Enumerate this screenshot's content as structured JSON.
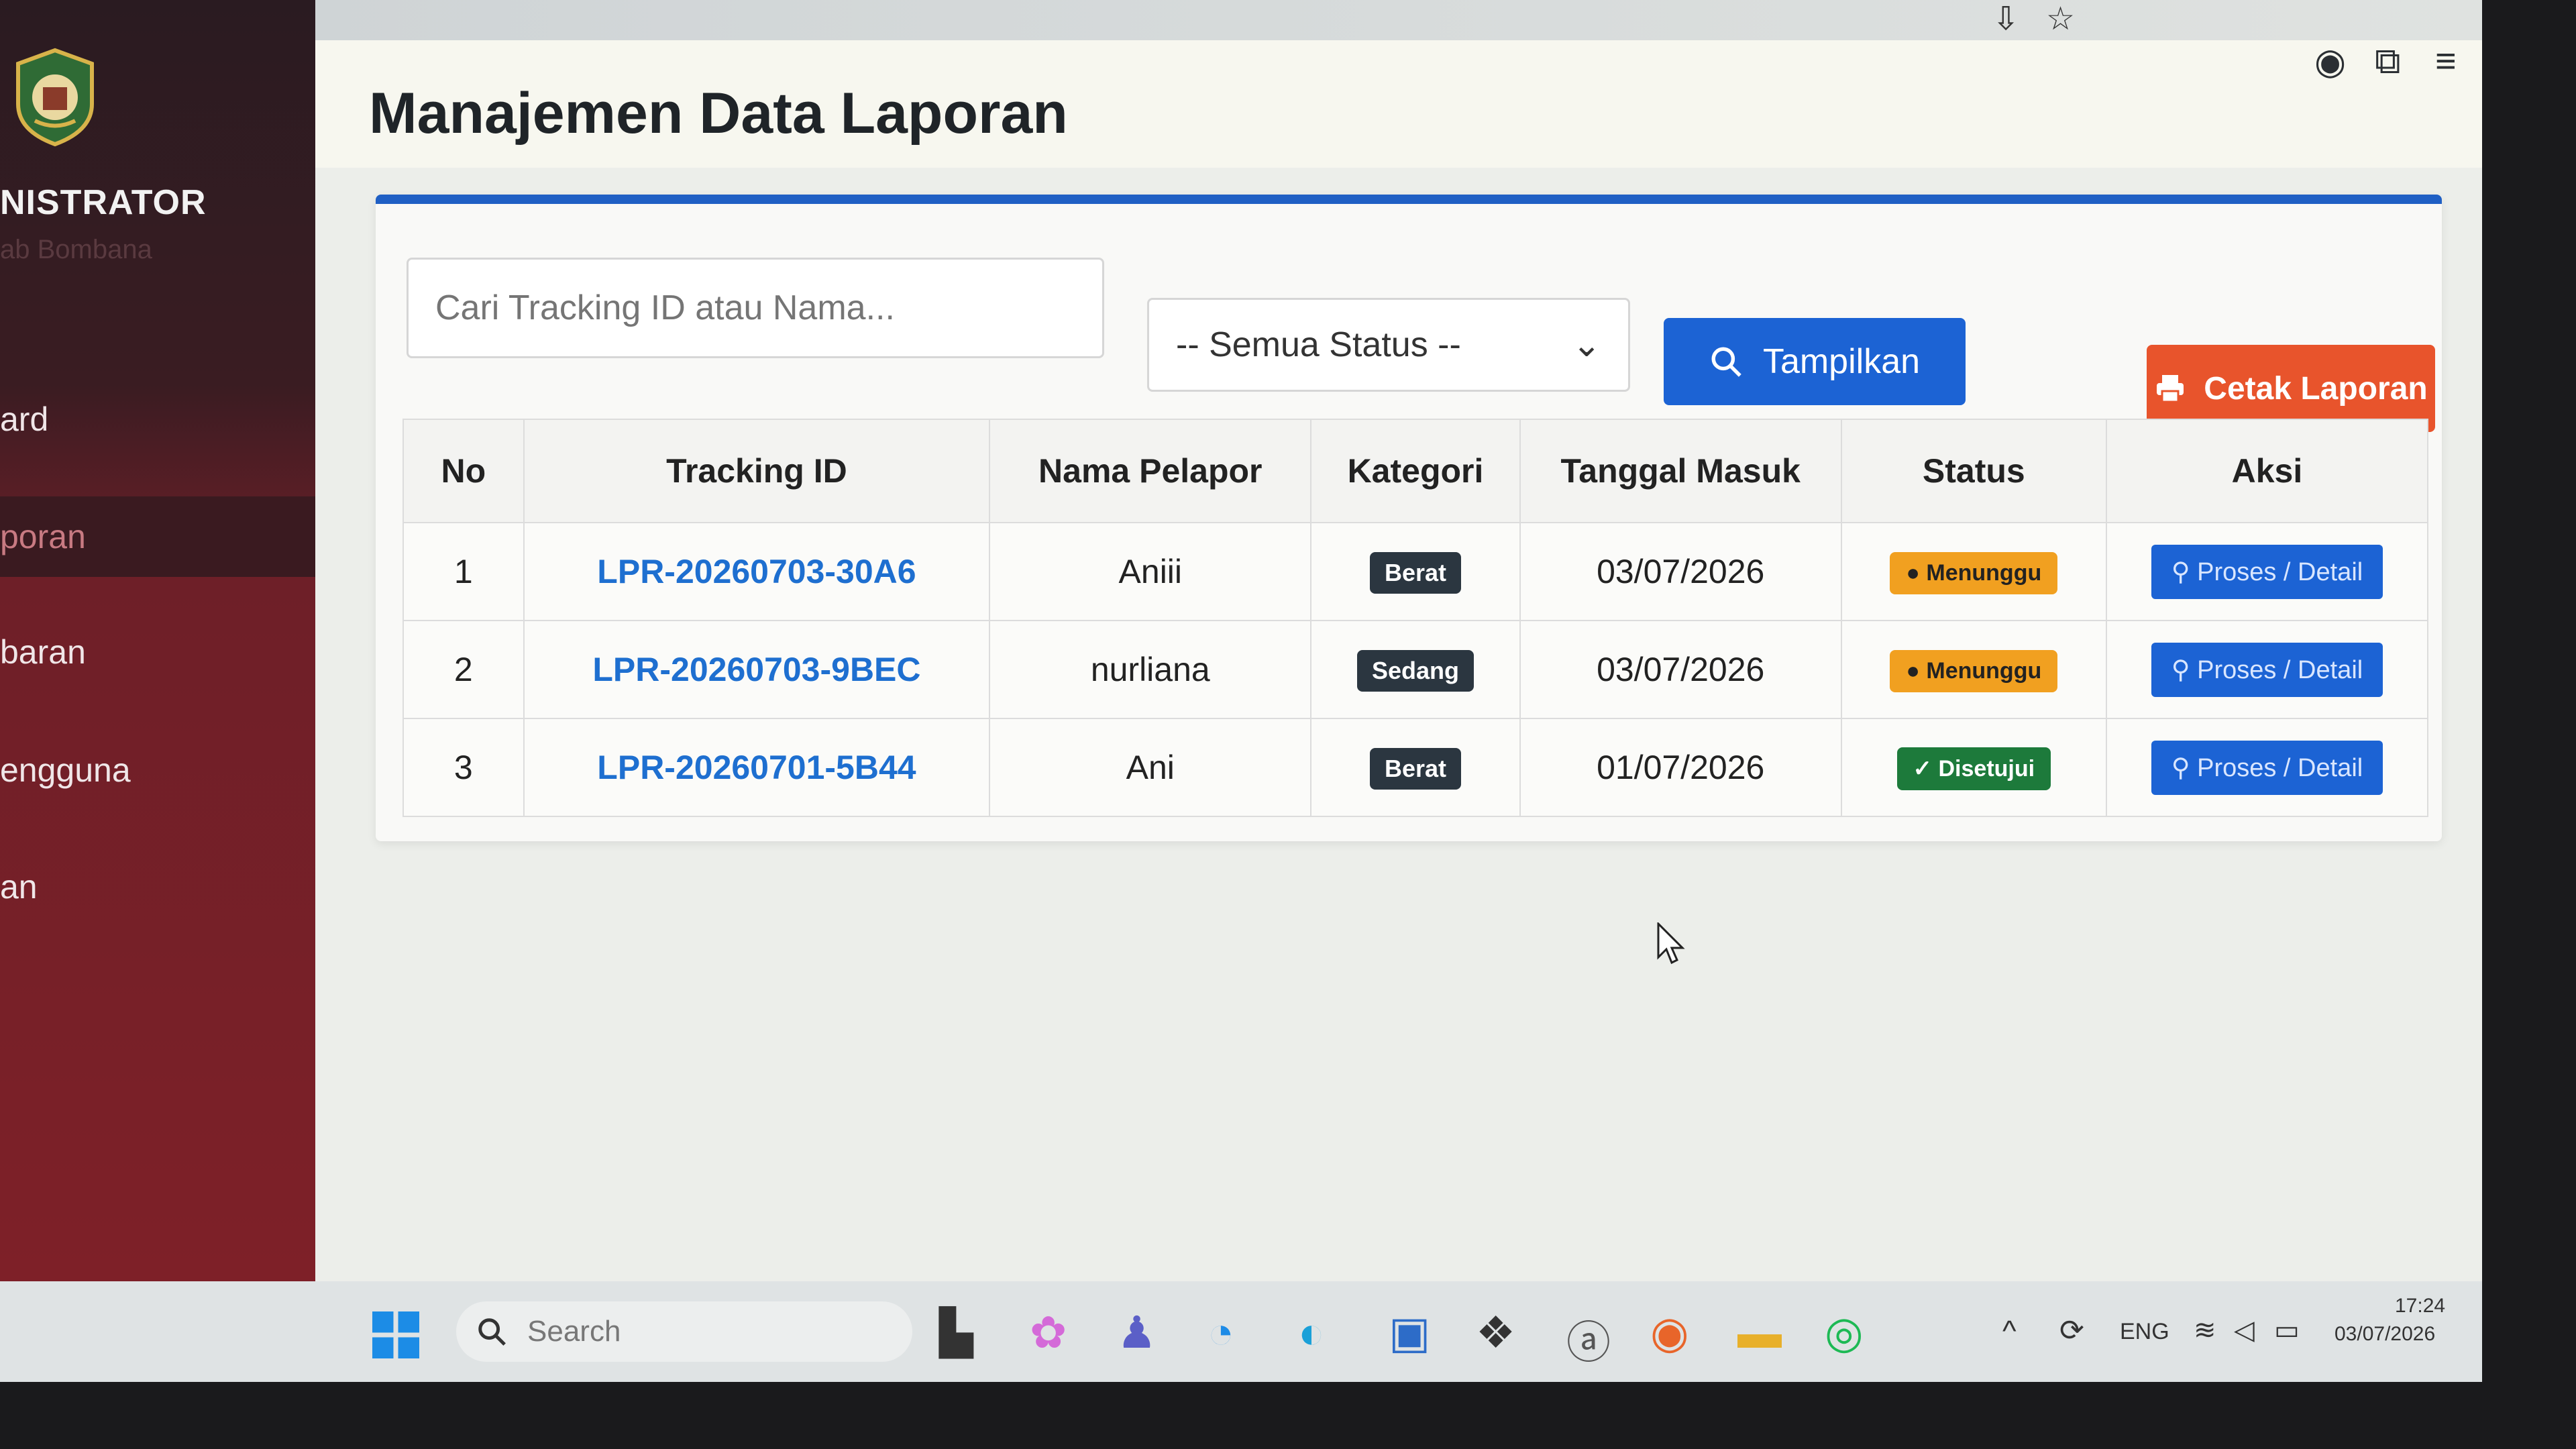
{
  "sidebar": {
    "role": "NISTRATOR",
    "subrole": "ab Bombana",
    "items": [
      {
        "label": "ard"
      },
      {
        "label": "poran"
      },
      {
        "label": "baran"
      },
      {
        "label": "engguna"
      },
      {
        "label": "an"
      }
    ]
  },
  "header": {
    "title": "Manajemen Data Laporan"
  },
  "filters": {
    "search_placeholder": "Cari Tracking ID atau Nama...",
    "status_selected": "-- Semua Status --",
    "show_label": "Tampilkan",
    "print_label": "Cetak Laporan"
  },
  "table": {
    "headers": [
      "No",
      "Tracking ID",
      "Nama Pelapor",
      "Kategori",
      "Tanggal Masuk",
      "Status",
      "Aksi"
    ],
    "rows": [
      {
        "no": "1",
        "tracking_id": "LPR-20260703-30A6",
        "nama": "Aniii",
        "kategori": "Berat",
        "tanggal": "03/07/2026",
        "status": "Menunggu",
        "aksi": "Proses / Detail"
      },
      {
        "no": "2",
        "tracking_id": "LPR-20260703-9BEC",
        "nama": "nurliana",
        "kategori": "Sedang",
        "tanggal": "03/07/2026",
        "status": "Menunggu",
        "aksi": "Proses / Detail"
      },
      {
        "no": "3",
        "tracking_id": "LPR-20260701-5B44",
        "nama": "Ani",
        "kategori": "Berat",
        "tanggal": "01/07/2026",
        "status": "Disetujui",
        "aksi": "Proses / Detail"
      }
    ]
  },
  "taskbar": {
    "search_label": "Search",
    "lang": "ENG",
    "time": "17:24",
    "date": "03/07/2026"
  },
  "colors": {
    "primary": "#1c63d4",
    "print": "#e8542c",
    "warning": "#f1a020",
    "success": "#1d7a3b",
    "sidebar": "#7e2028"
  }
}
